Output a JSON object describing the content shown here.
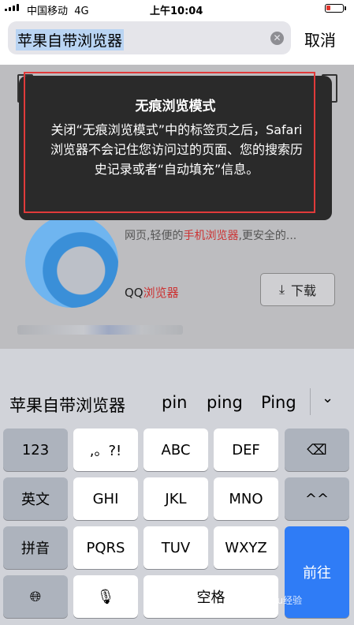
{
  "status_bar": {
    "carrier": "中国移动",
    "network": "4G",
    "time": "上午10:04"
  },
  "search": {
    "query": "苹果自带浏览器",
    "cancel_label": "取消",
    "clear_icon": "clear-icon"
  },
  "popup": {
    "title": "无痕浏览模式",
    "body": "关闭“无痕浏览模式”中的标签页之后，Safari浏览器不会记住您访问过的页面、您的搜索历史记录或者“自动填充”信息。"
  },
  "app_card": {
    "desc_prefix": "网页,轻便的",
    "desc_highlight": "手机浏览器",
    "desc_suffix": ",更安全的...",
    "name_prefix": "QQ",
    "name_highlight": "浏览器",
    "download_label": "下载"
  },
  "suggestions": [
    "苹果自带浏览器",
    "pin",
    "ping",
    "Ping"
  ],
  "keyboard": {
    "row1": [
      "123",
      ",。?!",
      "ABC",
      "DEF"
    ],
    "row2": [
      "英文",
      "GHI",
      "JKL",
      "MNO",
      "^^"
    ],
    "row3": [
      "拼音",
      "PQRS",
      "TUV",
      "WXYZ"
    ],
    "row4_space": "空格",
    "go_label": "前往"
  },
  "watermark": "Baidu经验",
  "colors": {
    "accent": "#2f7cf6",
    "highlight": "#cc3333",
    "annotation": "#e03a3a"
  }
}
